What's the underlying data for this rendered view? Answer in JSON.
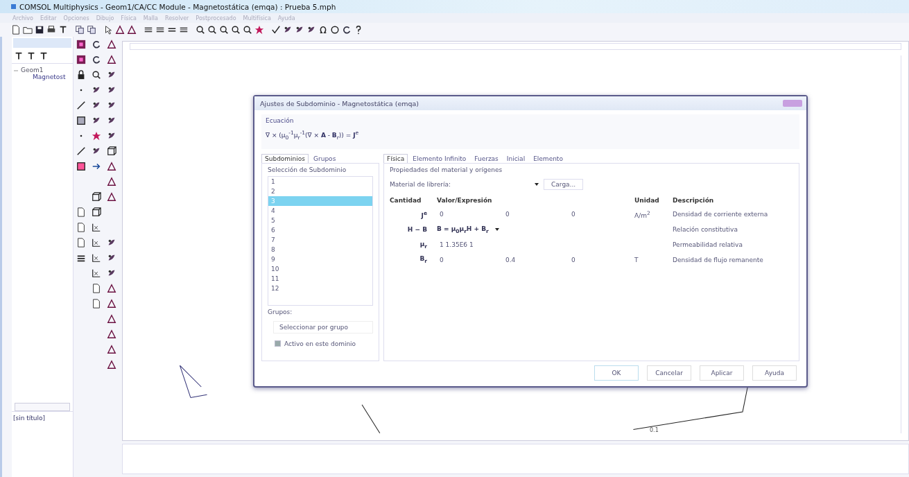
{
  "window": {
    "title": "COMSOL Multiphysics - Geom1/CA/CC Module - Magnetostática (emqa) : Prueba 5.mph"
  },
  "menu": [
    "Archivo",
    "Editar",
    "Opciones",
    "Dibujo",
    "Física",
    "Malla",
    "Resolver",
    "Postprocesado",
    "Multifísica",
    "Ayuda"
  ],
  "model_tree": {
    "items": [
      {
        "label": "Geom1",
        "expanded": true,
        "children": [
          {
            "label": "Magnetost"
          }
        ]
      }
    ]
  },
  "history": {
    "items": [
      "[sin título]"
    ]
  },
  "canvas": {
    "label": "0.1"
  },
  "dialog": {
    "title": "Ajustes de Subdominio - Magnetostática (emqa)",
    "equation_label": "Ecuación",
    "equation": "∇ × (μ$_{0}$$^{-1}$μ$_{r}$$^{-1}$(∇ × **A** - **B**$_{r}$)) = **J**$^{e}$",
    "left_tabs": [
      {
        "label": "Subdominios",
        "selected": true
      },
      {
        "label": "Grupos",
        "selected": false
      }
    ],
    "selection_label": "Selección de Subdominio",
    "subdomains": [
      {
        "label": "1",
        "selected": false
      },
      {
        "label": "2",
        "selected": false
      },
      {
        "label": "3",
        "selected": true
      },
      {
        "label": "4",
        "selected": false
      },
      {
        "label": "5",
        "selected": false
      },
      {
        "label": "6",
        "selected": false
      },
      {
        "label": "7",
        "selected": false
      },
      {
        "label": "8",
        "selected": false
      },
      {
        "label": "9",
        "selected": false
      },
      {
        "label": "10",
        "selected": false
      },
      {
        "label": "11",
        "selected": false
      },
      {
        "label": "12",
        "selected": false
      }
    ],
    "groups_label": "Grupos:",
    "group_button": "Seleccionar por grupo",
    "active_checkbox": {
      "label": "Activo en este dominio",
      "checked": true
    },
    "right_tabs": [
      {
        "label": "Física",
        "selected": true
      },
      {
        "label": "Elemento Infinito",
        "selected": false
      },
      {
        "label": "Fuerzas",
        "selected": false
      },
      {
        "label": "Inicial",
        "selected": false
      },
      {
        "label": "Elemento",
        "selected": false
      }
    ],
    "section_label": "Propiedades del material y orígenes",
    "library_label": "Material de librería:",
    "load_button": "Carga...",
    "columns": [
      "Cantidad",
      "Valor/Expresión",
      "Unidad",
      "Descripción"
    ],
    "rows": [
      {
        "kind": "vector",
        "quantity": "**J**$^{e}$",
        "values": [
          "0",
          "0",
          "0"
        ],
        "unit": "A/m$^{2}$",
        "description": "Densidad de corriente externa"
      },
      {
        "kind": "relation",
        "quantity": "H − B",
        "value": "B = μ$_{0}$μ$_{r}$H + B$_{r}$",
        "description": "Relación constitutiva"
      },
      {
        "kind": "scalar",
        "quantity": "μ$_{r}$",
        "value": "1 1.35E6 1",
        "description": "Permeabilidad relativa"
      },
      {
        "kind": "vector",
        "quantity": "**B**$_{r}$",
        "values": [
          "0",
          "0.4",
          "0"
        ],
        "unit": "T",
        "description": "Densidad de flujo remanente"
      }
    ],
    "buttons": [
      "OK",
      "Cancelar",
      "Aplicar",
      "Ayuda"
    ]
  }
}
